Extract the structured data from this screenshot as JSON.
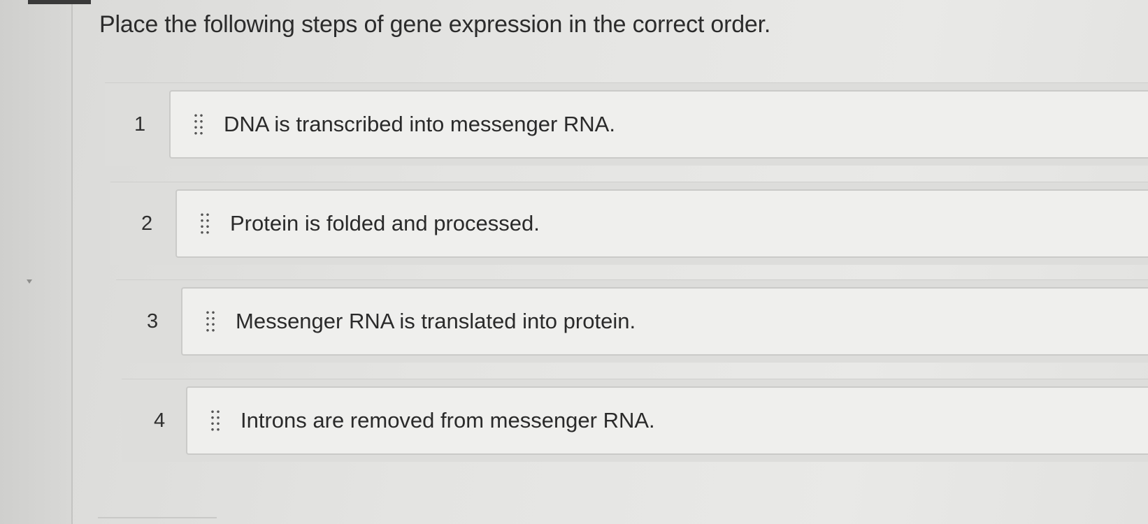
{
  "question": "Place the following steps of gene expression in the correct order.",
  "steps": [
    {
      "number": "1",
      "text": "DNA is transcribed into messenger RNA."
    },
    {
      "number": "2",
      "text": "Protein is folded and processed."
    },
    {
      "number": "3",
      "text": "Messenger RNA is translated into protein."
    },
    {
      "number": "4",
      "text": "Introns are removed from messenger RNA."
    }
  ],
  "icons": {
    "drag_handle": "drag-handle-icon"
  }
}
